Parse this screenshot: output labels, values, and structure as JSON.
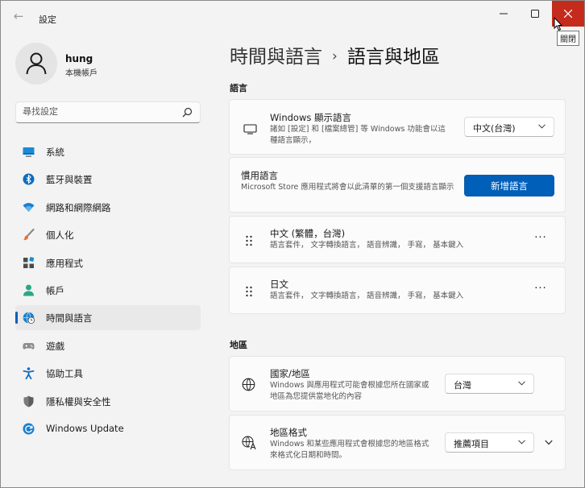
{
  "window": {
    "app_title": "設定",
    "tooltip": "關閉",
    "back_glyph": "←"
  },
  "profile": {
    "name": "hung",
    "account_type": "本機帳戶"
  },
  "search": {
    "placeholder": "尋找設定"
  },
  "sidebar": {
    "items": [
      {
        "label": "系統",
        "icon": "system-icon"
      },
      {
        "label": "藍牙與裝置",
        "icon": "bluetooth-icon"
      },
      {
        "label": "網路和網際網路",
        "icon": "wifi-icon"
      },
      {
        "label": "個人化",
        "icon": "brush-icon"
      },
      {
        "label": "應用程式",
        "icon": "apps-icon"
      },
      {
        "label": "帳戶",
        "icon": "account-icon"
      },
      {
        "label": "時間與語言",
        "icon": "globe-clock-icon",
        "selected": true
      },
      {
        "label": "遊戲",
        "icon": "gamepad-icon"
      },
      {
        "label": "協助工具",
        "icon": "accessibility-icon"
      },
      {
        "label": "隱私權與安全性",
        "icon": "shield-icon"
      },
      {
        "label": "Windows Update",
        "icon": "update-icon"
      }
    ]
  },
  "header": {
    "parent": "時間與語言",
    "separator": "›",
    "current": "語言與地區"
  },
  "language_section": {
    "title": "語言",
    "display_language": {
      "title": "Windows 顯示語言",
      "description": "諸如 [設定] 和 [檔案總管] 等 Windows 功能會以這種語言顯示，",
      "value": "中文(台灣)"
    },
    "preferred_languages": {
      "title": "慣用語言",
      "description": "Microsoft Store 應用程式將會以此清單的第一個支援語言顯示",
      "button_label": "新增語言"
    },
    "languages": [
      {
        "name": "中文 (繁體，台灣)",
        "features": "語言套件， 文字轉換語言， 語音辨識， 手寫， 基本鍵入"
      },
      {
        "name": "日文",
        "features": "語言套件， 文字轉換語言， 語音辨識， 手寫， 基本鍵入"
      }
    ],
    "more_glyph": "···"
  },
  "region_section": {
    "title": "地區",
    "country": {
      "title": "國家/地區",
      "description": "Windows 與應用程式可能會根據您所在國家或地區為您提供當地化的內容",
      "value": "台灣"
    },
    "format": {
      "title": "地區格式",
      "description": "Windows 和某些應用程式會根據您的地區格式來格式化日期和時間。",
      "value": "推薦項目"
    }
  },
  "colors": {
    "accent": "#005fb8",
    "close_hover": "#c42b1c"
  }
}
